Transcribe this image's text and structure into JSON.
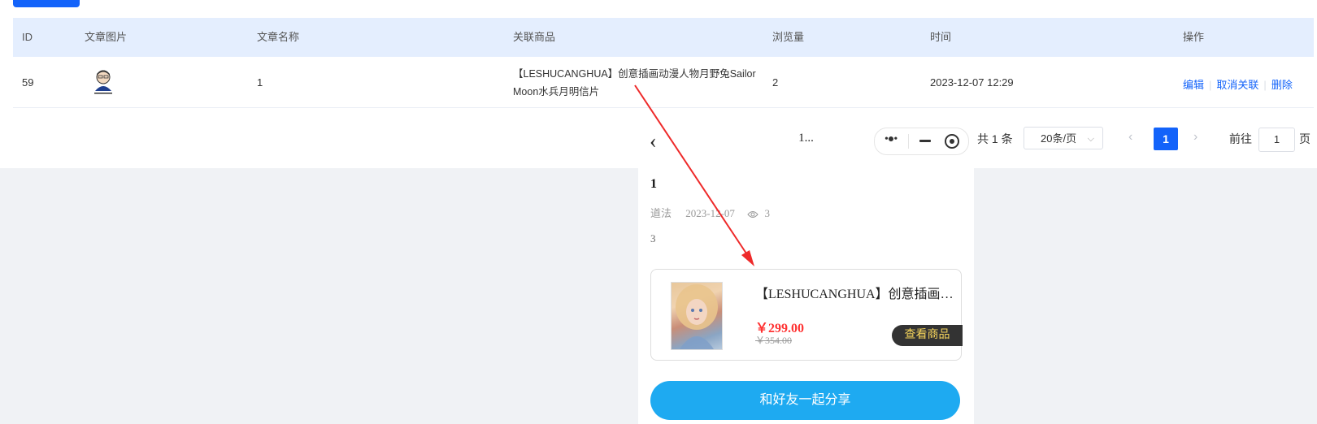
{
  "table": {
    "headers": {
      "id": "ID",
      "image": "文章图片",
      "name": "文章名称",
      "product": "关联商品",
      "views": "浏览量",
      "time": "时间",
      "ops": "操作"
    },
    "row": {
      "id": "59",
      "name": "1",
      "product_line1": "【LESHUCANGHUA】创意插画动漫人物月野兔Sailor",
      "product_line2": "Moon水兵月明信片",
      "views": "2",
      "time": "2023-12-07 12:29",
      "op_edit": "编辑",
      "op_unlink": "取消关联",
      "op_delete": "删除"
    }
  },
  "pagination": {
    "total": "共 1 条",
    "page_size": "20条/页",
    "prev": "‹",
    "current": "1",
    "next": "›",
    "goto_label": "前往",
    "goto_value": "1",
    "page_unit": "页"
  },
  "preview": {
    "back": "‹",
    "title": "1...",
    "article_title": "1",
    "author": "道法",
    "date": "2023-12-07",
    "views": "3",
    "body": "3",
    "product_name": "【LESHUCANGHUA】创意插画动漫人物月野兔Sailor Moon水兵月明信片",
    "price": "￥299.00",
    "original_price": "￥354.00",
    "view_button": "查看商品",
    "share_button": "和好友一起分享"
  },
  "colors": {
    "accent": "#1363fa",
    "header_bg": "#e4eefe",
    "share": "#1eaaf1",
    "price": "#ff3333",
    "arrow": "#ee2a2a"
  }
}
